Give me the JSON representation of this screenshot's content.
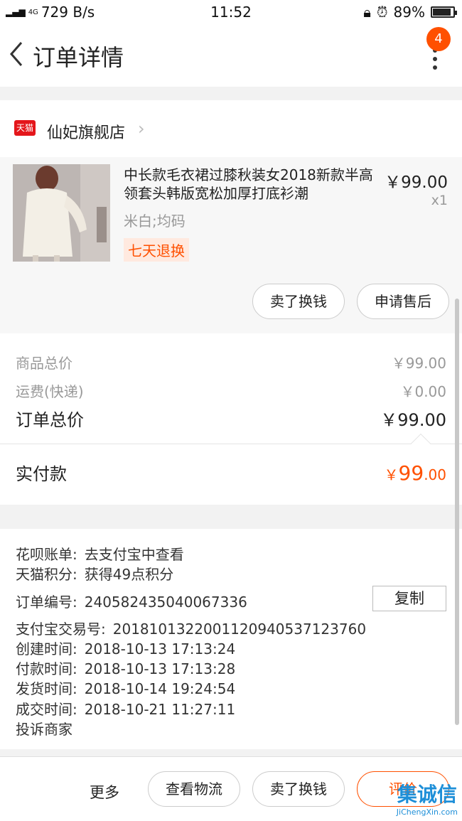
{
  "status_bar": {
    "network": "4G",
    "speed": "729 B/s",
    "time": "11:52",
    "battery": "89%"
  },
  "header": {
    "title": "订单详情",
    "badge_count": "4"
  },
  "shop": {
    "badge_text": "天猫",
    "name": "仙妃旗舰店"
  },
  "product": {
    "title": "中长款毛衣裙过膝秋装女2018新款半高领套头韩版宽松加厚打底衫潮",
    "sku": "米白;均码",
    "tag": "七天退换",
    "price": "￥99.00",
    "qty": "x1",
    "buttons": {
      "sell": "卖了换钱",
      "after_sale": "申请售后"
    }
  },
  "pricing": {
    "goods_label": "商品总价",
    "goods_value": "￥99.00",
    "shipping_label": "运费(快递)",
    "shipping_value": "￥0.00",
    "total_label": "订单总价",
    "total_value": "￥99.00",
    "paid_label": "实付款",
    "paid_currency": "￥",
    "paid_int": "99",
    "paid_dec": ".00"
  },
  "info": {
    "huabei_label": "花呗账单:",
    "huabei_value": "去支付宝中查看",
    "points_label": "天猫积分:",
    "points_value": "获得49点积分",
    "order_no_label": "订单编号:",
    "order_no_value": "240582435040067336",
    "copy_label": "复制",
    "alipay_label": "支付宝交易号:",
    "alipay_value": "2018101322001120940537123760",
    "created_label": "创建时间:",
    "created_value": "2018-10-13 17:13:24",
    "paid_label": "付款时间:",
    "paid_value": "2018-10-13 17:13:28",
    "shipped_label": "发货时间:",
    "shipped_value": "2018-10-14 19:24:54",
    "completed_label": "成交时间:",
    "completed_value": "2018-10-21 11:27:11",
    "complaint": "投诉商家"
  },
  "footer": {
    "more": "更多",
    "logistics": "查看物流",
    "sell": "卖了换钱",
    "review": "评价"
  },
  "watermark": {
    "main": "集诚信",
    "sub": "JiChengXin.com"
  },
  "colors": {
    "accent": "#ff5000",
    "tmall_red": "#e4161b"
  }
}
